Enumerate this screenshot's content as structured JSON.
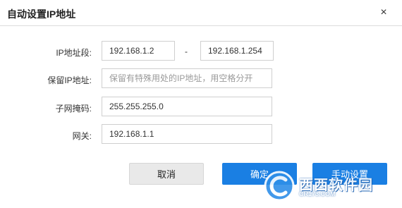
{
  "dialog": {
    "title": "自动设置IP地址",
    "close_symbol": "×"
  },
  "form": {
    "ip_range_label": "IP地址段:",
    "ip_start_value": "192.168.1.2",
    "range_separator": "-",
    "ip_end_value": "192.168.1.254",
    "reserved_label": "保留IP地址:",
    "reserved_placeholder": "保留有特殊用处的IP地址，用空格分开",
    "subnet_label": "子网掩码:",
    "subnet_value": "255.255.255.0",
    "gateway_label": "网关:",
    "gateway_value": "192.168.1.1"
  },
  "buttons": {
    "cancel_label": "取消",
    "ok_label": "确定",
    "manual_label": "手动设置"
  },
  "watermark": {
    "brand": "西西软件园",
    "site": "CR173.COM"
  },
  "colors": {
    "primary": "#1a7fe3",
    "cancel_bg": "#e9e9e9"
  }
}
